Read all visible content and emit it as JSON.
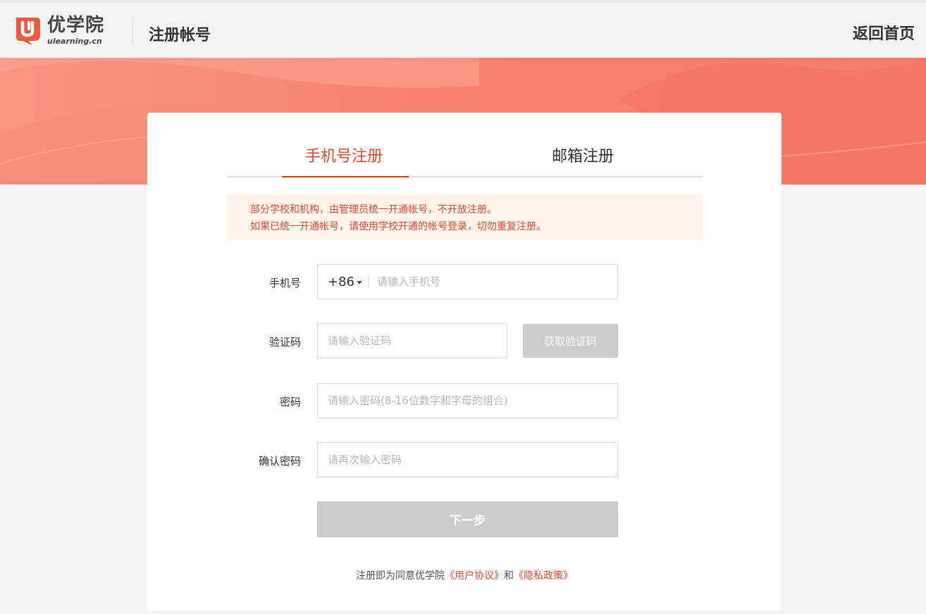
{
  "header": {
    "logo_cn": "优学院",
    "logo_en": "ulearning.cn",
    "title": "注册帐号",
    "back_home": "返回首页"
  },
  "tabs": [
    {
      "label": "手机号注册",
      "active": true
    },
    {
      "label": "邮箱注册",
      "active": false
    }
  ],
  "notice": {
    "line1": "部分学校和机构，由管理员统一开通帐号，不开放注册。",
    "line2": "如果已统一开通帐号，请使用学校开通的帐号登录，切勿重复注册。"
  },
  "form": {
    "phone": {
      "label": "手机号",
      "country_code": "+86",
      "placeholder": "请输入手机号",
      "value": ""
    },
    "code": {
      "label": "验证码",
      "placeholder": "请输入验证码",
      "value": "",
      "button": "获取验证码"
    },
    "password": {
      "label": "密码",
      "placeholder": "请输入密码(8-16位数字和字母的组合)",
      "value": ""
    },
    "confirm": {
      "label": "确认密码",
      "placeholder": "请再次输入密码",
      "value": ""
    },
    "next": "下一步"
  },
  "agreement": {
    "prefix": "注册即为同意优学院",
    "terms": "《用户协议》",
    "and": "和",
    "privacy": "《隐私政策》"
  },
  "colors": {
    "accent": "#e24a34",
    "banner": "#f7806f",
    "disabled_button": "#cccccc",
    "notice_bg": "#fdf4ea"
  }
}
